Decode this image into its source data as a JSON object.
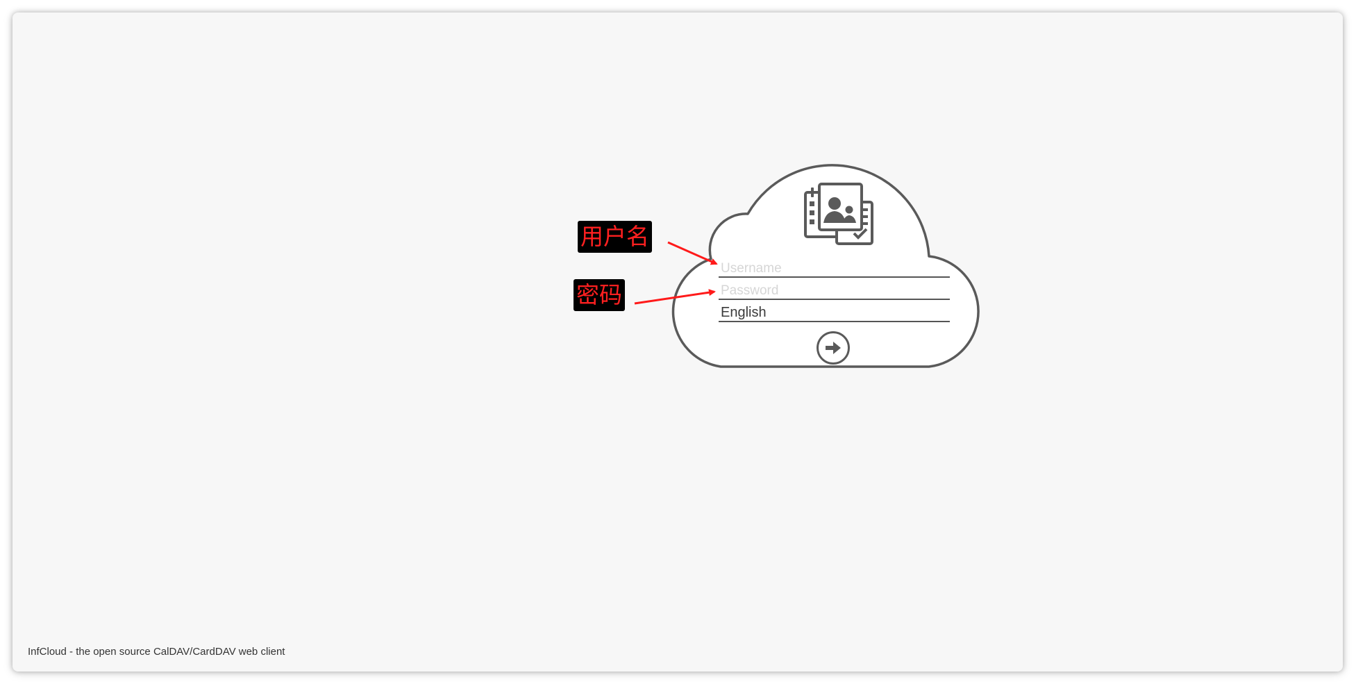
{
  "login": {
    "username_placeholder": "Username",
    "username_value": "",
    "password_placeholder": "Password",
    "password_value": "",
    "language_selected": "English",
    "submit_icon": "arrow-right-icon"
  },
  "logo": {
    "icon": "calendar-contacts-icon"
  },
  "annotations": {
    "username_label": "用户名",
    "password_label": "密码",
    "color": "#ff2020"
  },
  "footer": {
    "text": "InfCloud - the open source CalDAV/CardDAV web client"
  },
  "colors": {
    "background": "#f7f7f7",
    "cloud_fill": "#ffffff",
    "cloud_stroke": "#5a5a5a",
    "annotation_bg": "#000000"
  }
}
